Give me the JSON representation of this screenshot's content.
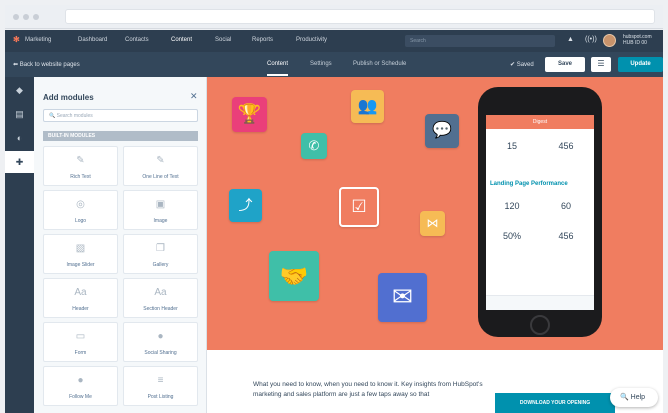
{
  "nav": {
    "items": [
      "Marketing",
      "Dashboard",
      "Contacts",
      "Content",
      "Social",
      "Reports",
      "Productivity"
    ],
    "search_placeholder": "Search",
    "account_line1": "hubspot.com",
    "account_line2": "HUB ID 00"
  },
  "editor": {
    "back_label": "Back to website pages",
    "tabs": [
      "Content",
      "Settings",
      "Publish or Schedule"
    ],
    "saved_label": "Saved",
    "save_label": "Save",
    "update_label": "Update"
  },
  "panel": {
    "title": "Add modules",
    "search_placeholder": "Search modules",
    "section": "BUILT-IN MODULES",
    "modules": [
      "Rich Text",
      "One Line of Text",
      "Logo",
      "Image",
      "Image Slider",
      "Gallery",
      "Header",
      "Section Header",
      "Form",
      "Social Sharing",
      "Follow Me",
      "Post Listing"
    ]
  },
  "phone": {
    "header": "Digest",
    "stat1": "15",
    "stat2": "456",
    "section_title": "Landing Page Performance",
    "stat3": "120",
    "stat4": "60",
    "stat5": "50%",
    "stat6": "456"
  },
  "body_text": "What you need to know, when you need to know it. Key insights from HubSpot's marketing and sales platform are just a few taps away so that",
  "download_label": "DOWNLOAD YOUR OPENING",
  "help_label": "Help",
  "colors": {
    "canvas": "#f07d60",
    "accent": "#0091ae",
    "nav": "#2d3e50"
  }
}
